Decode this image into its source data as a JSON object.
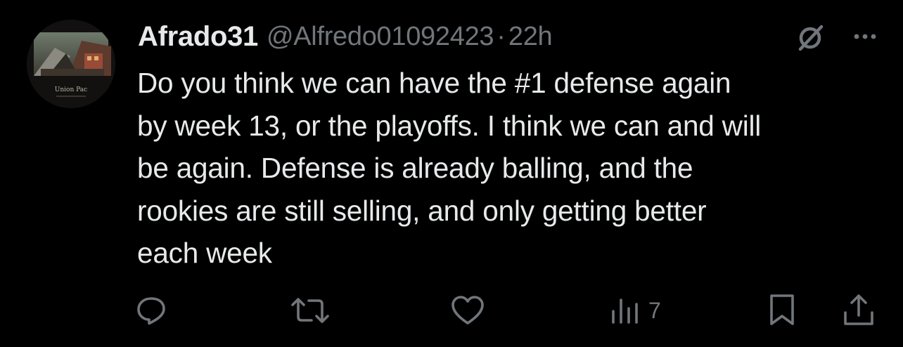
{
  "tweet": {
    "author": {
      "display_name": "Afrado31",
      "handle": "@Alfredo01092423",
      "avatar_caption": "Union Pac"
    },
    "separator": "·",
    "timestamp": "22h",
    "text": "Do you think we can have the #1 defense again\nby week 13, or the playoffs. I think we can and will\nbe again. Defense is already balling, and the\nrookies are still selling, and only getting better\neach week",
    "header_icons": [
      "grok-icon",
      "more-icon"
    ],
    "actions": {
      "reply_icon": "reply-icon",
      "retweet_icon": "retweet-icon",
      "like_icon": "heart-icon",
      "views_icon": "views-icon",
      "views_count": "7",
      "bookmark_icon": "bookmark-icon",
      "share_icon": "share-icon"
    }
  },
  "colors": {
    "background": "#000000",
    "text": "#e7e9ea",
    "secondary": "#71767b"
  }
}
